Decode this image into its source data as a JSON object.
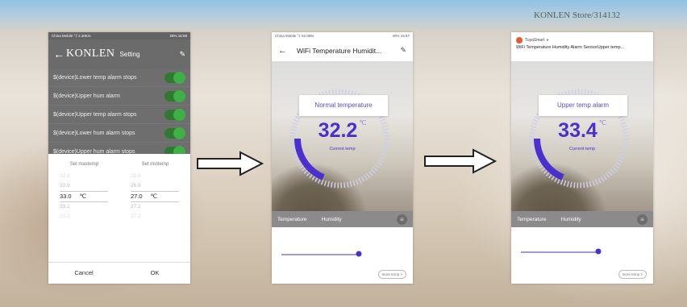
{
  "watermark": "KONLEN Store/314132",
  "phone1": {
    "status_left": "China Mobile °‡ 2.40K/s",
    "status_right": "28% 15:59",
    "header": {
      "back": "←",
      "brand": "KONLEN",
      "title": "Setting"
    },
    "rows": [
      "$(device)Lower temp alarm stops",
      "$(device)Upper hum alarm",
      "$(device)Upper temp alarm stops",
      "$(device)Lower hum alarm stops",
      "$(device)Upper hum alarm stops"
    ],
    "picker": {
      "label_max": "Set maxtemp",
      "label_min": "Set mintemp",
      "max_values": [
        "32.8",
        "32.9",
        "33.0",
        "33.1",
        "33.2"
      ],
      "min_values": [
        "26.8",
        "26.9",
        "27.0",
        "27.1",
        "27.2"
      ],
      "unit": "℃",
      "cancel": "Cancel",
      "ok": "OK"
    }
  },
  "phone2": {
    "status_left": "China Mobile °‡ 52.0B/s",
    "status_right": "40% 15:57",
    "title": "WiFi Temperature Humidit...",
    "card": "Normal temperature",
    "temp_value": "32.2",
    "temp_unit": "℃",
    "sub": "Current temp",
    "tab_temp": "Temperature",
    "tab_hum": "Humidity",
    "more": "more temp >"
  },
  "phone3": {
    "app": "TuyaSmart",
    "title": "WiFi Temperature Humidity Alarm SensorUpper temp...",
    "card": "Upper temp alarm",
    "temp_value": "33.4",
    "temp_unit": "℃",
    "sub": "Current temp",
    "tab_temp": "Temperature",
    "tab_hum": "Humidity",
    "more": "more temp >"
  },
  "colors": {
    "accent": "#4b2fd0",
    "toggle": "#3db144"
  },
  "icons": {
    "back": "back-arrow-icon",
    "edit": "edit-icon",
    "arrow": "flow-arrow-icon"
  }
}
